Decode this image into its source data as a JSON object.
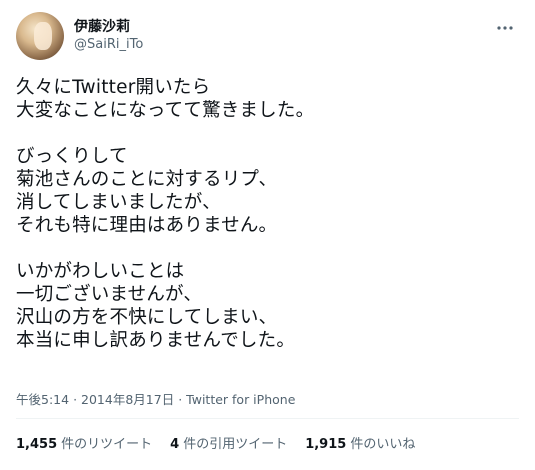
{
  "author": {
    "display_name": "伊藤沙莉",
    "username": "@SaiRi_iTo"
  },
  "tweet": {
    "text": "久々にTwitter開いたら\n大変なことになってて驚きました。\n\nびっくりして\n菊池さんのことに対するリプ、\n消してしまいましたが、\nそれも特に理由はありません。\n\nいかがわしいことは\n一切ございませんが、\n沢山の方を不快にしてしまい、\n本当に申し訳ありませんでした。",
    "time": "午後5:14",
    "separator": "·",
    "date": "2014年8月17日",
    "source": "Twitter for iPhone"
  },
  "stats": {
    "retweets": {
      "count": "1,455",
      "label": "件のリツイート"
    },
    "quotes": {
      "count": "4",
      "label": "件の引用ツイート"
    },
    "likes": {
      "count": "1,915",
      "label": "件のいいね"
    }
  },
  "icons": {
    "more": "more-horizontal-icon"
  },
  "colors": {
    "text_primary": "#0f1419",
    "text_secondary": "#536471",
    "divider": "#eff3f4"
  }
}
